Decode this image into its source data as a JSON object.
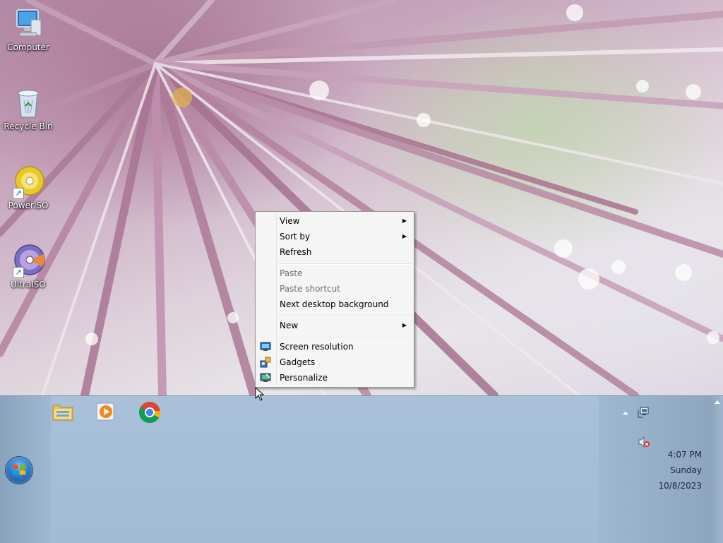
{
  "desktop": {
    "icons": [
      {
        "label": "Computer",
        "icon": "computer-icon"
      },
      {
        "label": "Recycle Bin",
        "icon": "recycle-bin-icon"
      },
      {
        "label": "PowerISO",
        "icon": "poweriso-icon"
      },
      {
        "label": "UltraISO",
        "icon": "ultraiso-icon"
      }
    ]
  },
  "context_menu": {
    "items": [
      {
        "label": "View",
        "submenu": true,
        "enabled": true
      },
      {
        "label": "Sort by",
        "submenu": true,
        "enabled": true
      },
      {
        "label": "Refresh",
        "submenu": false,
        "enabled": true
      },
      {
        "label": "Paste",
        "submenu": false,
        "enabled": false
      },
      {
        "label": "Paste shortcut",
        "submenu": false,
        "enabled": false
      },
      {
        "label": "Next desktop background",
        "submenu": false,
        "enabled": true
      },
      {
        "label": "New",
        "submenu": true,
        "enabled": true
      },
      {
        "label": "Screen resolution",
        "submenu": false,
        "enabled": true,
        "icon": "screen-resolution-icon"
      },
      {
        "label": "Gadgets",
        "submenu": false,
        "enabled": true,
        "icon": "gadgets-icon"
      },
      {
        "label": "Personalize",
        "submenu": false,
        "enabled": true,
        "icon": "personalize-icon"
      }
    ]
  },
  "taskbar": {
    "pinned": [
      {
        "name": "Windows Explorer",
        "icon": "folder-icon"
      },
      {
        "name": "Windows Media Player",
        "icon": "media-player-icon"
      },
      {
        "name": "Google Chrome",
        "icon": "chrome-icon"
      }
    ],
    "tray": {
      "icons": [
        "show-hidden-icons-icon",
        "network-icon",
        "volume-muted-icon"
      ]
    },
    "clock": {
      "time": "4:07 PM",
      "day": "Sunday",
      "date": "10/8/2023"
    }
  },
  "colors": {
    "taskbar": "#a8c0d8",
    "menu_bg": "#f5f5f5",
    "disabled_text": "#6d6d6d"
  }
}
